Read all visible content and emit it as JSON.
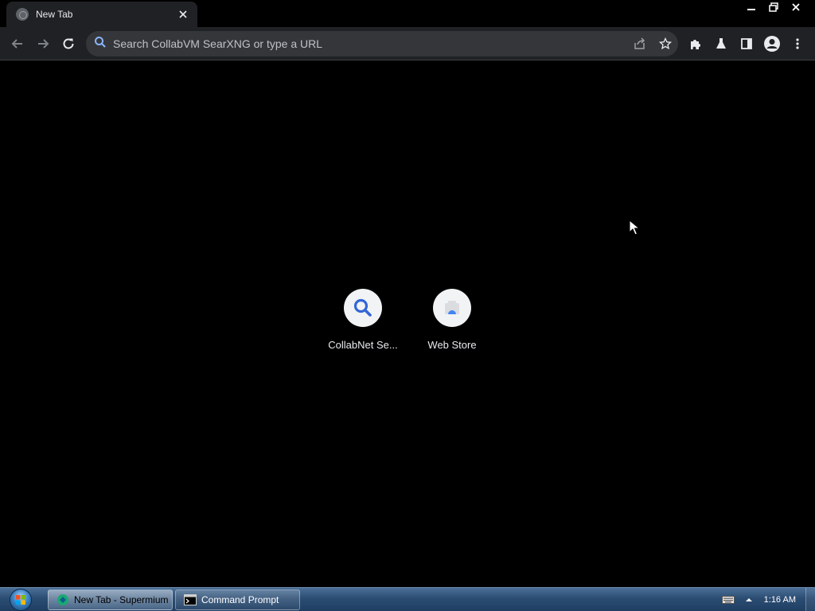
{
  "browser": {
    "tab": {
      "title": "New Tab",
      "favicon": "globe-icon",
      "close_icon": "close-icon"
    },
    "window_controls": {
      "minimize": "minimize-icon",
      "restore": "restore-icon",
      "close": "close-icon"
    },
    "toolbar": {
      "back": "arrow-left-icon",
      "forward": "arrow-right-icon",
      "reload": "reload-icon",
      "omnibox": {
        "placeholder": "Search CollabVM SearXNG or type a URL",
        "value": "",
        "search_icon": "search-icon"
      },
      "share": "share-icon",
      "bookmark": "star-icon",
      "extensions": "puzzle-icon",
      "labs": "flask-icon",
      "side_panel": "side-panel-icon",
      "profile": "avatar-icon",
      "menu": "three-dots-icon"
    },
    "shortcuts": [
      {
        "title": "CollabNet Se...",
        "icon": "magnifier-icon"
      },
      {
        "title": "Web Store",
        "icon": "webstore-icon"
      }
    ]
  },
  "taskbar": {
    "start": "windows-orb-icon",
    "buttons": [
      {
        "label": "New Tab - Supermium",
        "icon": "supermium-icon",
        "active": true
      },
      {
        "label": "Command Prompt",
        "icon": "cmd-icon",
        "active": false
      }
    ],
    "tray": {
      "keyboard": "keyboard-icon",
      "arrow": "show-hidden-icons-icon"
    },
    "clock": "1:16 AM"
  },
  "colors": {
    "accent": "#1a73e8",
    "toolbar_bg": "#202124",
    "omnibox_bg": "#35363a",
    "page_bg": "#000000"
  }
}
